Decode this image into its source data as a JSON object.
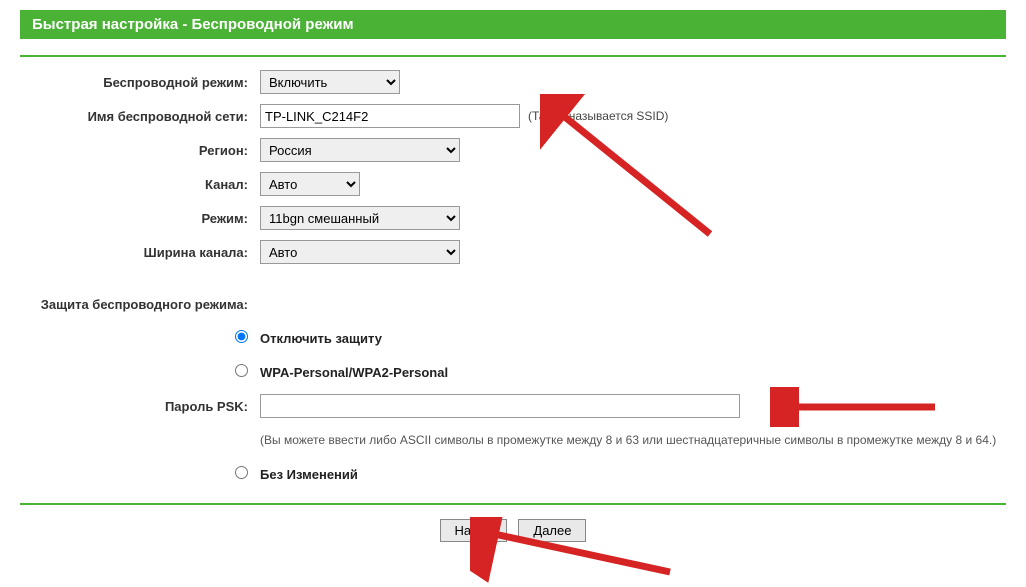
{
  "header": {
    "title": "Быстрая настройка - Беспроводной режим"
  },
  "form": {
    "wireless_mode_label": "Беспроводной режим:",
    "wireless_mode_value": "Включить",
    "ssid_label": "Имя беспроводной сети:",
    "ssid_value": "TP-LINK_C214F2",
    "ssid_hint": "(Также называется SSID)",
    "region_label": "Регион:",
    "region_value": "Россия",
    "channel_label": "Канал:",
    "channel_value": "Авто",
    "mode_label": "Режим:",
    "mode_value": "11bgn смешанный",
    "width_label": "Ширина канала:",
    "width_value": "Авто",
    "security_label": "Защита беспроводного режима:",
    "opt_disable": "Отключить защиту",
    "opt_wpa": "WPA-Personal/WPA2-Personal",
    "psk_label": "Пароль PSK:",
    "psk_value": "",
    "psk_hint": "(Вы можете ввести либо ASCII символы в промежутке между 8 и 63 или шестнадцатеричные символы в промежутке между 8 и 64.)",
    "opt_nochange": "Без Изменений"
  },
  "buttons": {
    "back": "Назад",
    "next": "Далее"
  }
}
